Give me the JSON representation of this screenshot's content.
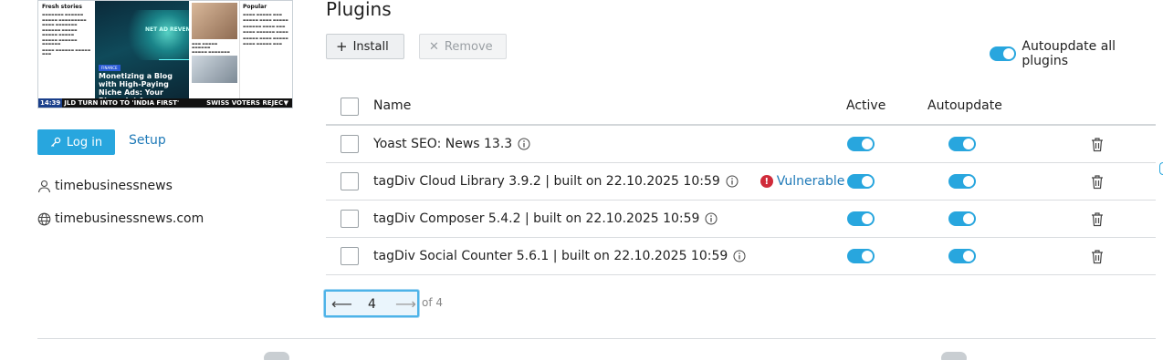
{
  "thumbnail": {
    "fresh_stories": "Fresh stories",
    "popular": "Popular",
    "hero_tag": "FINANCE",
    "hero_overlay": "NET AD REVENUE",
    "headline": "Monetizing a Blog with High-Paying Niche Ads: Your Blueprint for",
    "ticker_time": "14:39",
    "ticker_left": "JLD TURN INTO TO 'INDIA FIRST'",
    "ticker_right": "SWISS VOTERS REJEC"
  },
  "sidebar": {
    "login_label": "Log in",
    "setup_label": "Setup",
    "username": "timebusinessnews",
    "domain": "timebusinessnews.com"
  },
  "plugins": {
    "title": "Plugins",
    "install_label": "Install",
    "remove_label": "Remove",
    "autoupdate_all_label": "Autoupdate all plugins",
    "columns": {
      "name": "Name",
      "active": "Active",
      "autoupdate": "Autoupdate"
    },
    "rows": [
      {
        "name": "Yoast SEO: News 13.3",
        "active": true,
        "autoupdate": true
      },
      {
        "name": "tagDiv Cloud Library 3.9.2 | built on 22.10.2025 10:59",
        "active": true,
        "autoupdate": true,
        "badge": "Vulnerable"
      },
      {
        "name": "tagDiv Composer 5.4.2 | built on 22.10.2025 10:59",
        "active": true,
        "autoupdate": true
      },
      {
        "name": "tagDiv Social Counter 5.6.1 | built on 22.10.2025 10:59",
        "active": true,
        "autoupdate": true
      }
    ],
    "pagination": {
      "current_page": "4",
      "of_label": "of 4"
    }
  },
  "colors": {
    "accent": "#28a6de",
    "danger": "#d02b3a",
    "link": "#1f7ab8"
  }
}
